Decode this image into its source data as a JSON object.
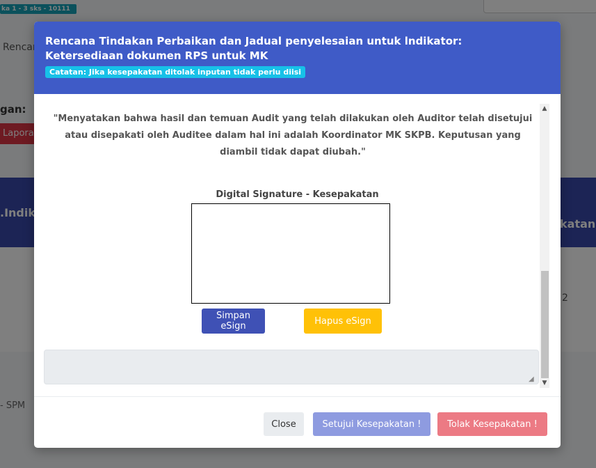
{
  "background": {
    "badge": "ka 1 - 3 sks - 10111",
    "rencana": "Rencar",
    "label_gan": "gan:",
    "laporan_button": "Lapora",
    "indik": ".Indik",
    "katan": "katan",
    "row_value": "2",
    "footer_text": "- SPM"
  },
  "modal": {
    "title": "Rencana Tindakan Perbaikan dan Jadual penyelesaian untuk lndikator: Ketersediaan dokumen RPS untuk MK",
    "note": "Catatan: Jika kesepakatan ditolak inputan tidak perlu diisi",
    "statement": "\"Menyatakan bahwa hasil dan temuan Audit yang telah dilakukan oleh Auditor telah disetujui atau disepakati oleh Auditee dalam hal ini adalah Koordinator MK SKPB. Keputusan yang diambil tidak dapat diubah.\"",
    "signature_label": "Digital Signature - Kesepakatan",
    "save_esign": "Simpan eSign",
    "delete_esign": "Hapus eSign",
    "textarea_value": "",
    "footer": {
      "close": "Close",
      "approve": "Setujui Kesepakatan !",
      "reject": "Tolak Kesepakatan !"
    }
  },
  "colors": {
    "header": "#3f5bc7",
    "note_badge": "#17c1e8",
    "save_button": "#3f51b5",
    "delete_button": "#ffc107",
    "approve_button": "#8e9be0",
    "reject_button": "#ec7a84"
  }
}
